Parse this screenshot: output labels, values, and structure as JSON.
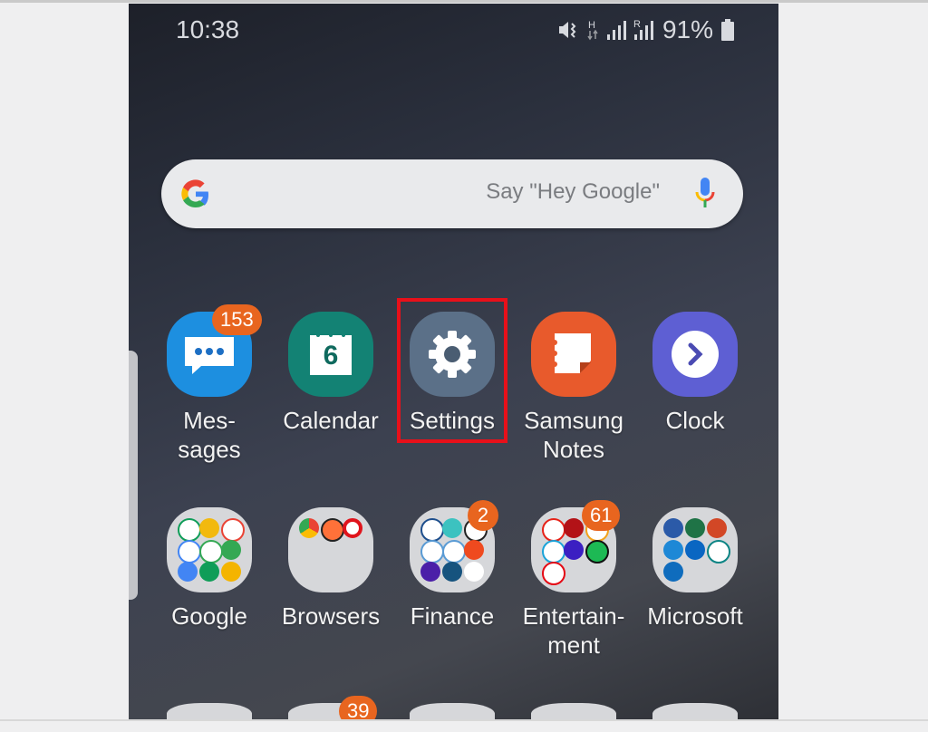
{
  "status_bar": {
    "time": "10:38",
    "battery": "91%",
    "icons": [
      "vibrate-icon",
      "hspa-data-icon",
      "signal-icon",
      "roaming-signal-icon",
      "battery-icon"
    ]
  },
  "search": {
    "placeholder": "Say \"Hey Google\"",
    "left_icon": "google-g-icon",
    "right_icon": "mic-icon"
  },
  "highlight": {
    "target": "Settings",
    "color": "#e8101a"
  },
  "apps_row1": [
    {
      "label": "Mes-\nsages",
      "icon": "messages-icon",
      "color": "#1d8fe0",
      "badge": "153"
    },
    {
      "label": "Calendar",
      "icon": "calendar-icon",
      "color": "#138274",
      "day": "6"
    },
    {
      "label": "Settings",
      "icon": "gear-icon",
      "color": "#5b7088"
    },
    {
      "label": "Samsung\nNotes",
      "icon": "notes-icon",
      "color": "#e85a2c"
    },
    {
      "label": "Clock",
      "icon": "clock-icon",
      "color": "#5e5fd3"
    }
  ],
  "folders_row2": [
    {
      "label": "Google",
      "icon": "google-folder-icon"
    },
    {
      "label": "Browsers",
      "icon": "browsers-folder-icon"
    },
    {
      "label": "Finance",
      "icon": "finance-folder-icon",
      "badge": "2"
    },
    {
      "label": "Entertain-\nment",
      "icon": "entertainment-folder-icon",
      "badge": "61"
    },
    {
      "label": "Microsoft",
      "icon": "microsoft-folder-icon"
    }
  ],
  "row3_badge": "39",
  "colors": {
    "badge": "#e8651f",
    "label": "#f3f3f3"
  }
}
